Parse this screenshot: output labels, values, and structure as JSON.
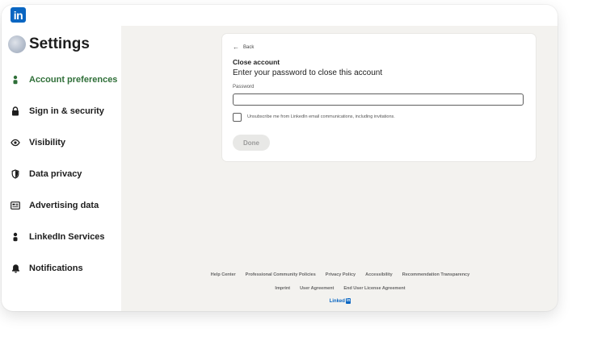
{
  "app": {
    "logo_text": "in",
    "brand_color": "#0a66c2"
  },
  "sidebar": {
    "title": "Settings",
    "items": [
      {
        "label": "Account preferences",
        "icon": "person-icon",
        "active": true
      },
      {
        "label": "Sign in & security",
        "icon": "lock-icon",
        "active": false
      },
      {
        "label": "Visibility",
        "icon": "eye-icon",
        "active": false
      },
      {
        "label": "Data privacy",
        "icon": "shield-icon",
        "active": false
      },
      {
        "label": "Advertising data",
        "icon": "newspaper-icon",
        "active": false
      },
      {
        "label": "LinkedIn Services",
        "icon": "person-icon",
        "active": false
      },
      {
        "label": "Notifications",
        "icon": "bell-icon",
        "active": false
      }
    ],
    "active_color": "#2f6f38"
  },
  "close_account": {
    "back_label": "Back",
    "title": "Close account",
    "subtitle": "Enter your password to close this account",
    "password_label": "Password",
    "password_value": "",
    "unsubscribe_label": "Unsubscribe me from LinkedIn email communications, including invitations.",
    "unsubscribe_checked": false,
    "done_label": "Done"
  },
  "footer": {
    "row1": [
      "Help Center",
      "Professional Community Policies",
      "Privacy Policy",
      "Accessibility",
      "Recommendation Transparency"
    ],
    "row2": [
      "Imprint",
      "User Agreement",
      "End User License Agreement"
    ],
    "brand_text": "Linked",
    "brand_logo": "in"
  }
}
